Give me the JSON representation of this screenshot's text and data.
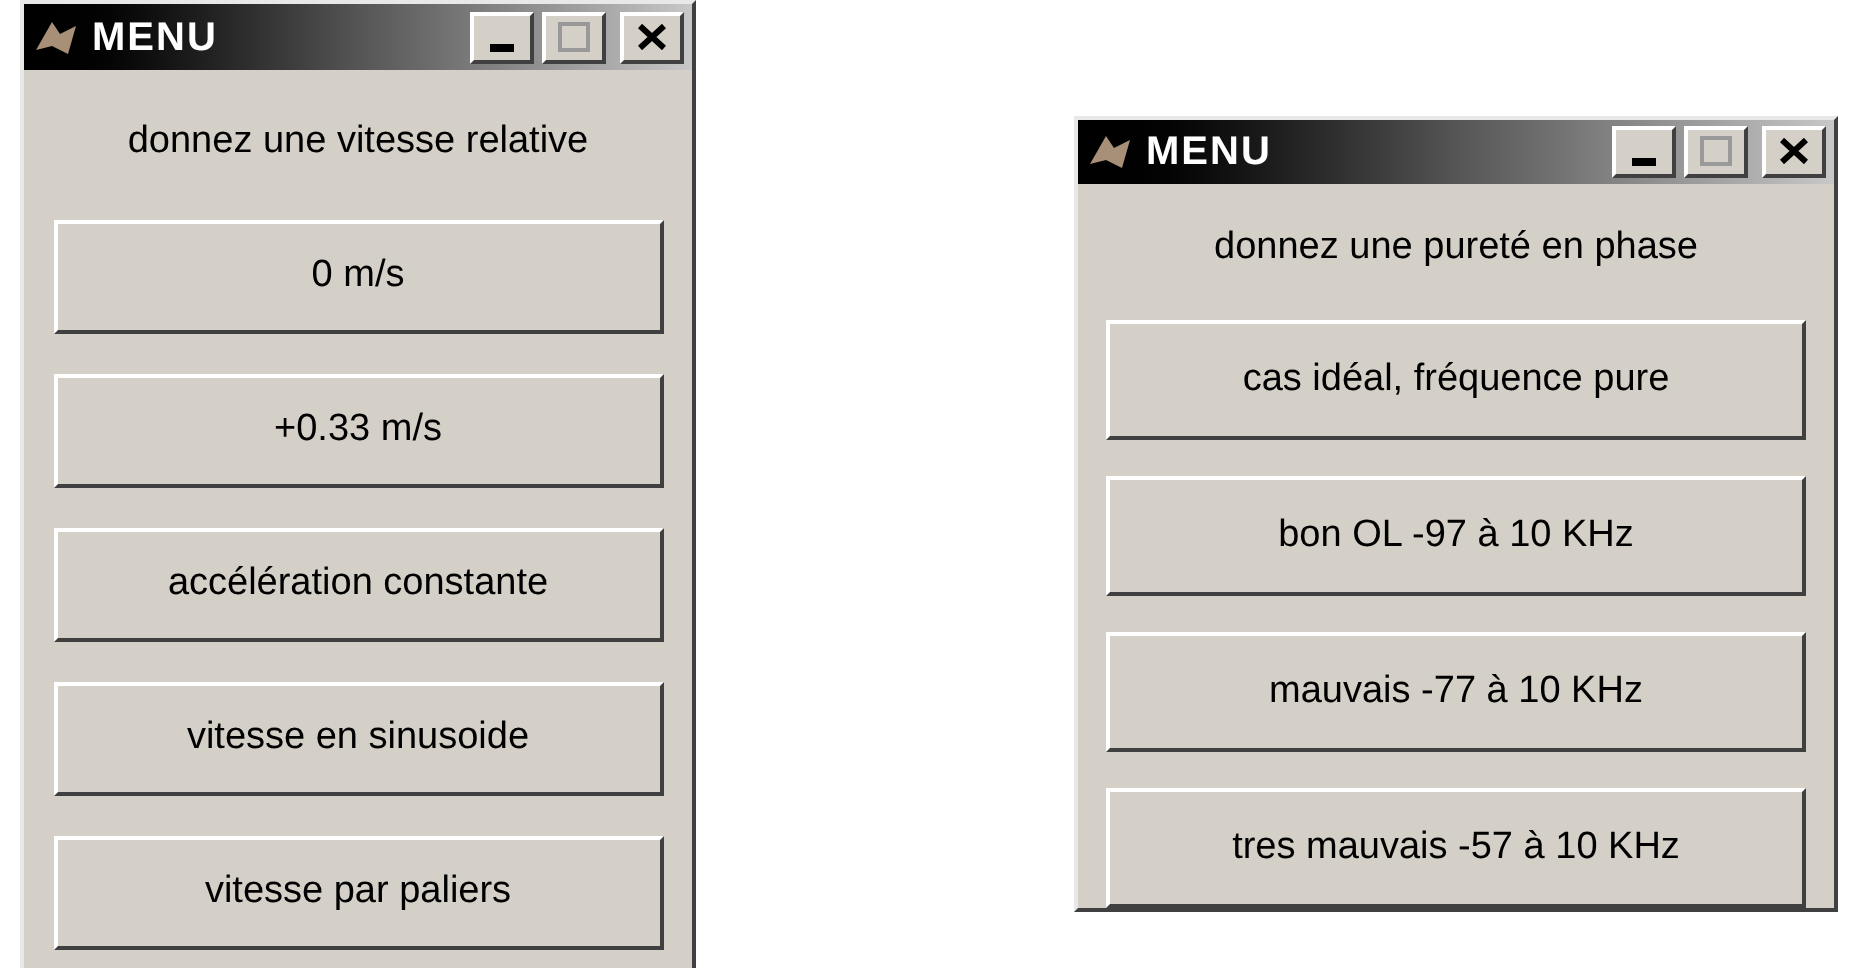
{
  "windows": [
    {
      "title": "MENU",
      "prompt": "donnez une vitesse relative",
      "buttons": [
        "0 m/s",
        "+0.33 m/s",
        "accélération constante",
        "vitesse en sinusoide",
        "vitesse par paliers"
      ]
    },
    {
      "title": "MENU",
      "prompt": "donnez une pureté en phase",
      "buttons": [
        "cas idéal, fréquence pure",
        "bon OL -97 à 10 KHz",
        "mauvais -77 à 10 KHz",
        "tres mauvais -57 à 10 KHz"
      ]
    }
  ]
}
